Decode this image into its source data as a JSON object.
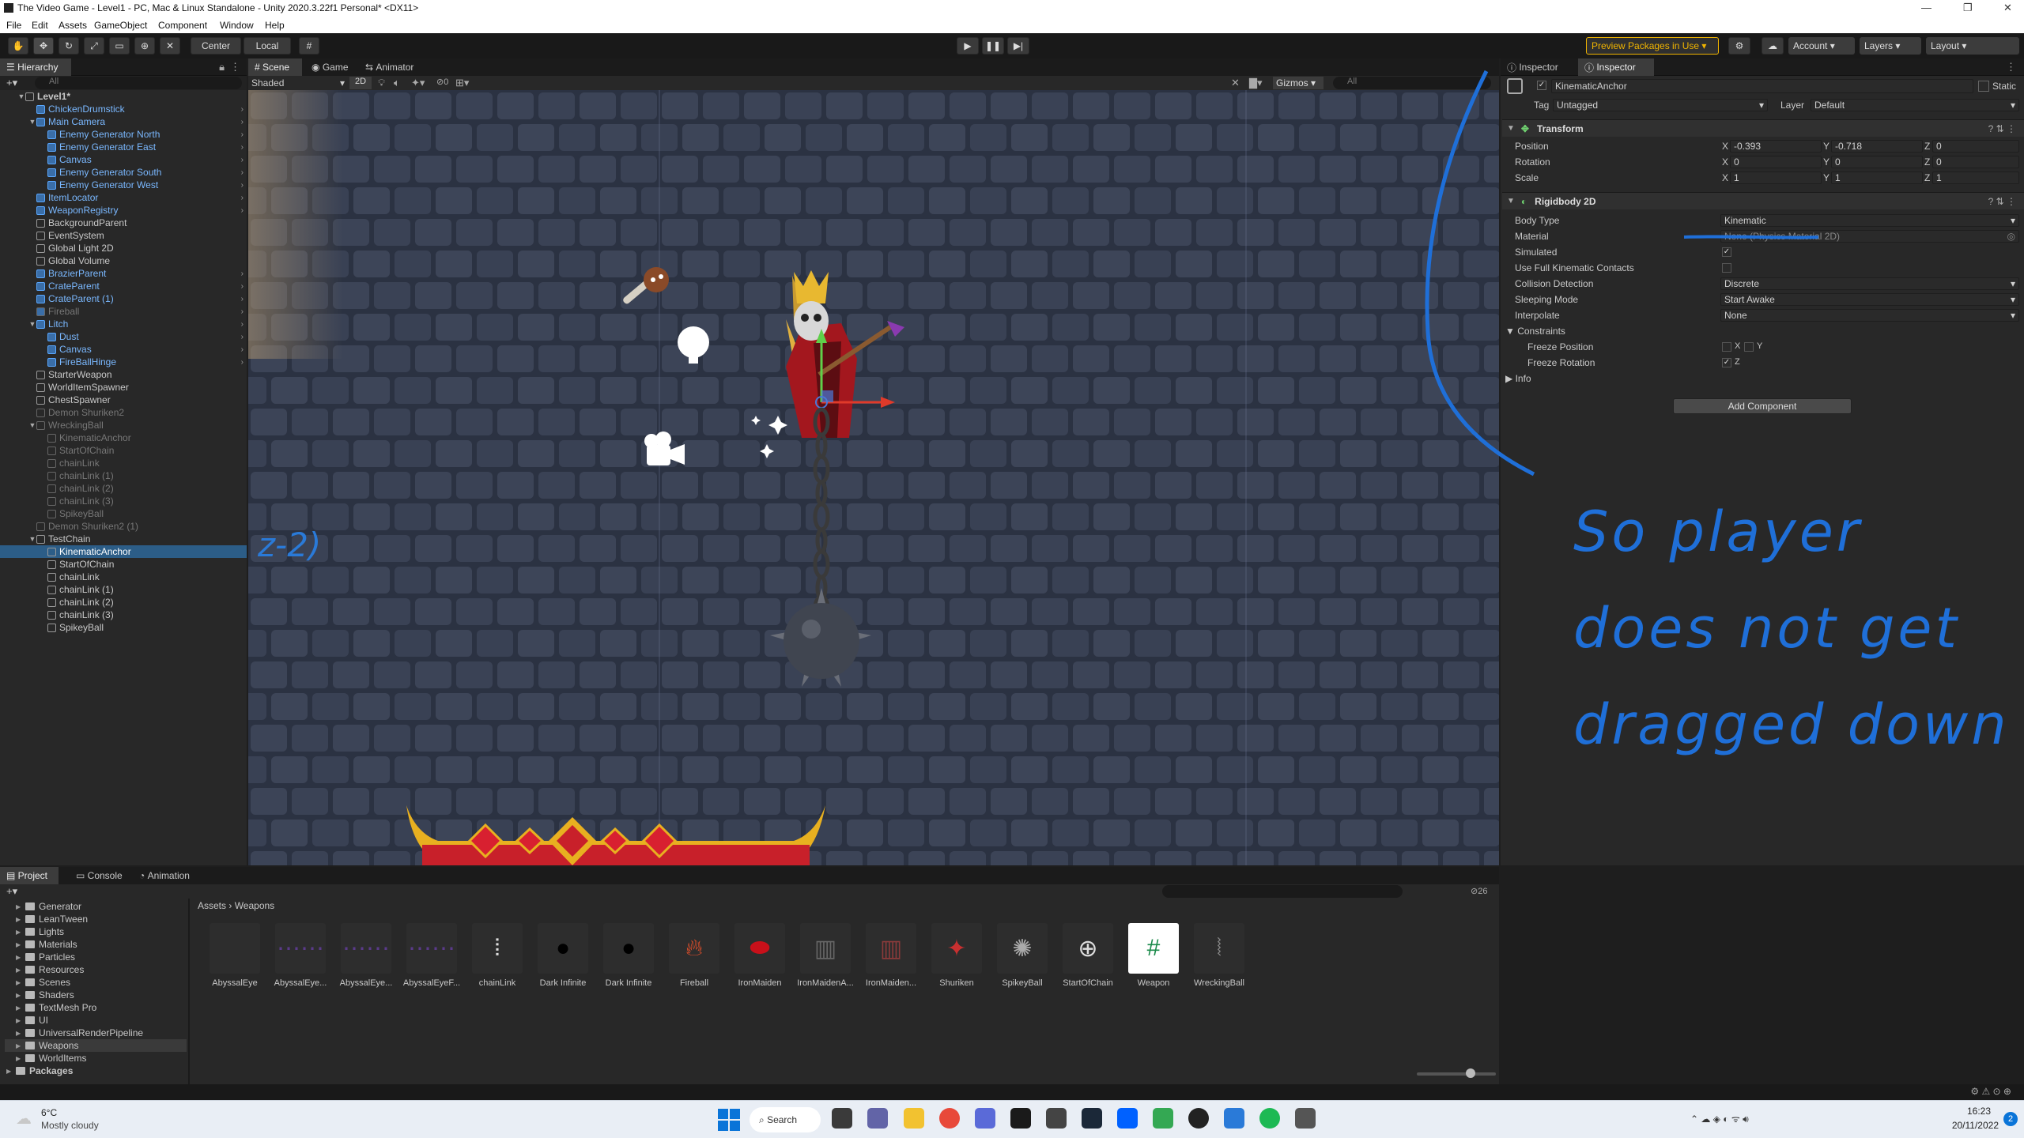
{
  "window": {
    "title": "The Video Game - Level1 - PC, Mac & Linux Standalone - Unity 2020.3.22f1 Personal* <DX11>"
  },
  "menu": [
    "File",
    "Edit",
    "Assets",
    "GameObject",
    "Component",
    "Window",
    "Help"
  ],
  "toolbar": {
    "center": "Center",
    "local": "Local",
    "preview_packages": "Preview Packages in Use",
    "account": "Account",
    "layers": "Layers",
    "layout": "Layout"
  },
  "hierarchy": {
    "tab": "Hierarchy",
    "search_placeholder": "All",
    "items": [
      {
        "label": "Level1*",
        "indent": 0,
        "kind": "scene"
      },
      {
        "label": "ChickenDrumstick",
        "indent": 1,
        "kind": "prefab"
      },
      {
        "label": "Main Camera",
        "indent": 1,
        "kind": "prefab"
      },
      {
        "label": "Enemy Generator North",
        "indent": 2,
        "kind": "prefab"
      },
      {
        "label": "Enemy Generator East",
        "indent": 2,
        "kind": "prefab"
      },
      {
        "label": "Canvas",
        "indent": 2,
        "kind": "prefab"
      },
      {
        "label": "Enemy Generator South",
        "indent": 2,
        "kind": "prefab"
      },
      {
        "label": "Enemy Generator West",
        "indent": 2,
        "kind": "prefab"
      },
      {
        "label": "ItemLocator",
        "indent": 1,
        "kind": "prefab"
      },
      {
        "label": "WeaponRegistry",
        "indent": 1,
        "kind": "prefab"
      },
      {
        "label": "BackgroundParent",
        "indent": 1,
        "kind": "normal"
      },
      {
        "label": "EventSystem",
        "indent": 1,
        "kind": "normal"
      },
      {
        "label": "Global Light 2D",
        "indent": 1,
        "kind": "normal"
      },
      {
        "label": "Global Volume",
        "indent": 1,
        "kind": "normal"
      },
      {
        "label": "BrazierParent",
        "indent": 1,
        "kind": "prefab"
      },
      {
        "label": "CrateParent",
        "indent": 1,
        "kind": "prefab"
      },
      {
        "label": "CrateParent (1)",
        "indent": 1,
        "kind": "prefab"
      },
      {
        "label": "Fireball",
        "indent": 1,
        "kind": "dimprefab"
      },
      {
        "label": "Litch",
        "indent": 1,
        "kind": "prefab"
      },
      {
        "label": "Dust",
        "indent": 2,
        "kind": "prefab"
      },
      {
        "label": "Canvas",
        "indent": 2,
        "kind": "prefab"
      },
      {
        "label": "FireBallHinge",
        "indent": 2,
        "kind": "prefab"
      },
      {
        "label": "StarterWeapon",
        "indent": 1,
        "kind": "normal"
      },
      {
        "label": "WorldItemSpawner",
        "indent": 1,
        "kind": "normal"
      },
      {
        "label": "ChestSpawner",
        "indent": 1,
        "kind": "normal"
      },
      {
        "label": "Demon Shuriken2",
        "indent": 1,
        "kind": "dim"
      },
      {
        "label": "WreckingBall",
        "indent": 1,
        "kind": "dim"
      },
      {
        "label": "KinematicAnchor",
        "indent": 2,
        "kind": "dim"
      },
      {
        "label": "StartOfChain",
        "indent": 2,
        "kind": "dim"
      },
      {
        "label": "chainLink",
        "indent": 2,
        "kind": "dim"
      },
      {
        "label": "chainLink (1)",
        "indent": 2,
        "kind": "dim"
      },
      {
        "label": "chainLink (2)",
        "indent": 2,
        "kind": "dim"
      },
      {
        "label": "chainLink (3)",
        "indent": 2,
        "kind": "dim"
      },
      {
        "label": "SpikeyBall",
        "indent": 2,
        "kind": "dim"
      },
      {
        "label": "Demon Shuriken2 (1)",
        "indent": 1,
        "kind": "dim"
      },
      {
        "label": "TestChain",
        "indent": 1,
        "kind": "normal"
      },
      {
        "label": "KinematicAnchor",
        "indent": 2,
        "kind": "selected"
      },
      {
        "label": "StartOfChain",
        "indent": 2,
        "kind": "normal"
      },
      {
        "label": "chainLink",
        "indent": 2,
        "kind": "normal"
      },
      {
        "label": "chainLink (1)",
        "indent": 2,
        "kind": "normal"
      },
      {
        "label": "chainLink (2)",
        "indent": 2,
        "kind": "normal"
      },
      {
        "label": "chainLink (3)",
        "indent": 2,
        "kind": "normal"
      },
      {
        "label": "SpikeyBall",
        "indent": 2,
        "kind": "normal"
      }
    ]
  },
  "scene": {
    "tabs": [
      "Scene",
      "Game",
      "Animator"
    ],
    "shading": "Shaded",
    "mode2d": "2D",
    "gizmos": "Gizmos",
    "search_placeholder": "All",
    "layers_count": "0"
  },
  "inspector": {
    "tabs": [
      "Inspector",
      "Inspector"
    ],
    "object_name": "KinematicAnchor",
    "static_label": "Static",
    "tag_label": "Tag",
    "tag": "Untagged",
    "layer_label": "Layer",
    "layer": "Default",
    "transform": {
      "title": "Transform",
      "position_label": "Position",
      "rotation_label": "Rotation",
      "scale_label": "Scale",
      "position": {
        "x": "-0.393",
        "y": "-0.718",
        "z": "0"
      },
      "rotation": {
        "x": "0",
        "y": "0",
        "z": "0"
      },
      "scale": {
        "x": "1",
        "y": "1",
        "z": "1"
      }
    },
    "rigidbody": {
      "title": "Rigidbody 2D",
      "body_type_label": "Body Type",
      "body_type": "Kinematic",
      "material_label": "Material",
      "material": "None (Physics Material 2D)",
      "simulated_label": "Simulated",
      "full_kinematic_label": "Use Full Kinematic Contacts",
      "collision_label": "Collision Detection",
      "collision": "Discrete",
      "sleeping_label": "Sleeping Mode",
      "sleeping": "Start Awake",
      "interpolate_label": "Interpolate",
      "interpolate": "None",
      "constraints_label": "Constraints",
      "freeze_pos_label": "Freeze Position",
      "freeze_rot_label": "Freeze Rotation",
      "info_label": "Info"
    },
    "add_component": "Add Component"
  },
  "annotation": {
    "lines": [
      "So player",
      "does not get",
      "dragged down"
    ],
    "margin_note": "z-2)"
  },
  "project": {
    "tabs": [
      "Project",
      "Console",
      "Animation"
    ],
    "breadcrumb": [
      "Assets",
      "Weapons"
    ],
    "hidden_count": "26",
    "folders": [
      "Generator",
      "LeanTween",
      "Lights",
      "Materials",
      "Particles",
      "Resources",
      "Scenes",
      "Shaders",
      "TextMesh Pro",
      "UI",
      "UniversalRenderPipeline",
      "Weapons",
      "WorldItems",
      "Packages"
    ],
    "assets": [
      "AbyssalEye",
      "AbyssalEye...",
      "AbyssalEye...",
      "AbyssalEyeF...",
      "chainLink",
      "Dark Infinite",
      "Dark Infinite",
      "Fireball",
      "IronMaiden",
      "IronMaidenA...",
      "IronMaiden...",
      "Shuriken",
      "SpikeyBall",
      "StartOfChain",
      "Weapon",
      "WreckingBall"
    ]
  },
  "taskbar": {
    "temperature": "6°C",
    "weather": "Mostly cloudy",
    "search": "Search",
    "time": "16:23",
    "date": "20/11/2022",
    "notif": "2"
  }
}
